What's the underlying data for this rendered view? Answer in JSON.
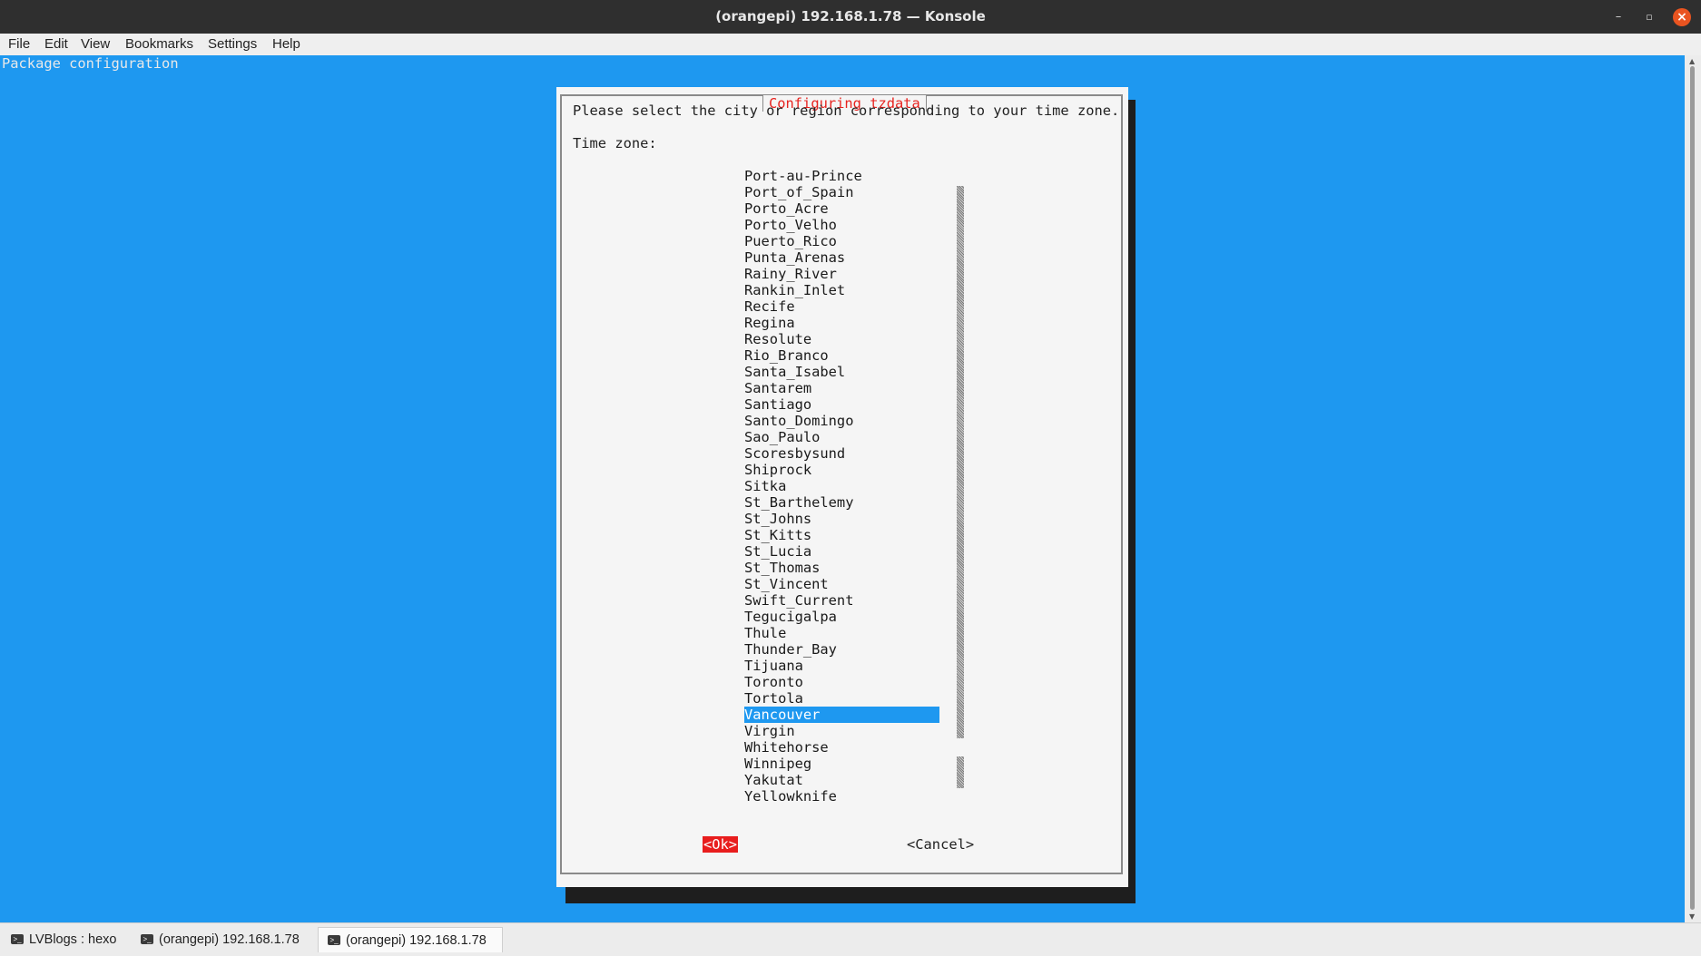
{
  "window": {
    "title": "(orangepi) 192.168.1.78 — Konsole",
    "minimize": "–",
    "maximize": "▫",
    "close": "×"
  },
  "menu": [
    "File",
    "Edit",
    "View",
    "Bookmarks",
    "Settings",
    "Help"
  ],
  "terminal": {
    "header": "Package configuration",
    "background": "#1e98f0"
  },
  "dialog": {
    "title": "Configuring tzdata",
    "prompt": "Please select the city or region corresponding to your time zone.",
    "label": "Time zone:",
    "items": [
      "Port-au-Prince",
      "Port_of_Spain",
      "Porto_Acre",
      "Porto_Velho",
      "Puerto_Rico",
      "Punta_Arenas",
      "Rainy_River",
      "Rankin_Inlet",
      "Recife",
      "Regina",
      "Resolute",
      "Rio_Branco",
      "Santa_Isabel",
      "Santarem",
      "Santiago",
      "Santo_Domingo",
      "Sao_Paulo",
      "Scoresbysund",
      "Shiprock",
      "Sitka",
      "St_Barthelemy",
      "St_Johns",
      "St_Kitts",
      "St_Lucia",
      "St_Thomas",
      "St_Vincent",
      "Swift_Current",
      "Tegucigalpa",
      "Thule",
      "Thunder_Bay",
      "Tijuana",
      "Toronto",
      "Tortola",
      "Vancouver",
      "Virgin",
      "Whitehorse",
      "Winnipeg",
      "Yakutat",
      "Yellowknife"
    ],
    "selected": "Vancouver",
    "ok": "<Ok>",
    "cancel": "<Cancel>"
  },
  "tabs": [
    {
      "label": "LVBlogs : hexo",
      "active": false
    },
    {
      "label": "(orangepi) 192.168.1.78",
      "active": false
    },
    {
      "label": "(orangepi) 192.168.1.78",
      "active": true
    }
  ]
}
